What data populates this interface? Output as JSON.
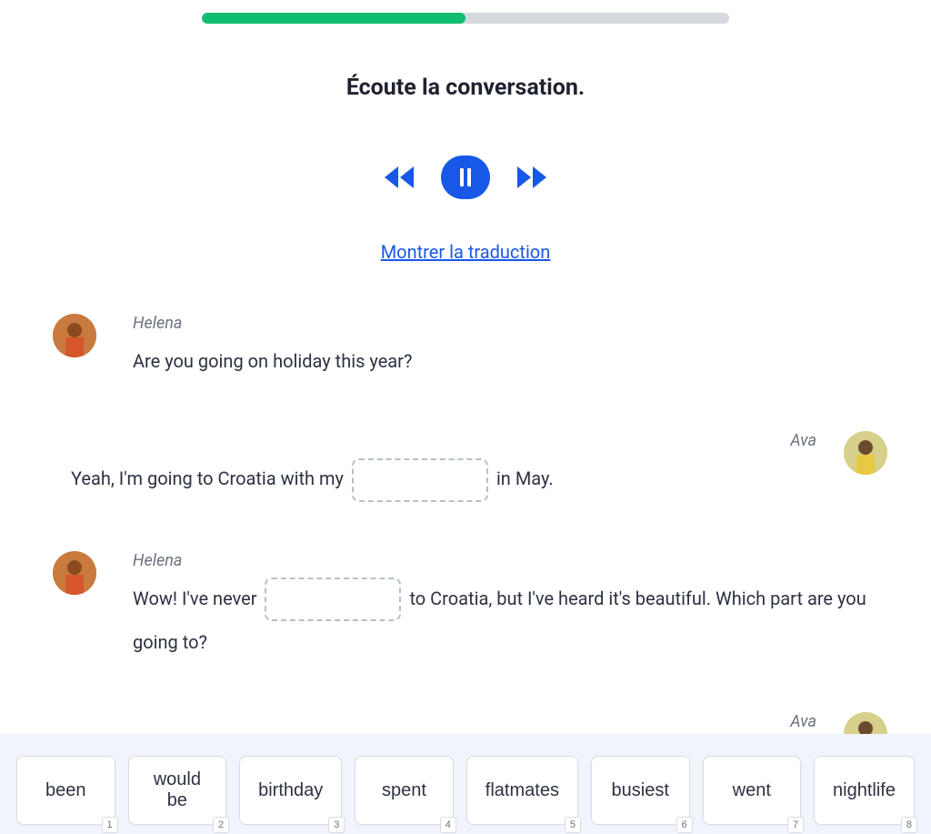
{
  "progress": {
    "percent": 50
  },
  "instruction": "Écoute la conversation.",
  "translation_link": "Montrer la traduction",
  "speakers": {
    "helena": "Helena",
    "ava": "Ava"
  },
  "messages": {
    "m1": {
      "speaker": "Helena",
      "text": "Are you going on holiday this year?"
    },
    "m2": {
      "speaker": "Ava",
      "text_before": "Yeah, I'm going to Croatia with my ",
      "text_after": " in May."
    },
    "m3": {
      "speaker": "Helena",
      "text_before": "Wow! I've never ",
      "text_after": " to Croatia, but I've heard it's beautiful. Which part are you going to?"
    },
    "m4": {
      "speaker": "Ava"
    }
  },
  "word_bank": [
    {
      "word": "been",
      "shortcut": "1"
    },
    {
      "word": "would be",
      "shortcut": "2"
    },
    {
      "word": "birthday",
      "shortcut": "3"
    },
    {
      "word": "spent",
      "shortcut": "4"
    },
    {
      "word": "flatmates",
      "shortcut": "5"
    },
    {
      "word": "busiest",
      "shortcut": "6"
    },
    {
      "word": "went",
      "shortcut": "7"
    },
    {
      "word": "nightlife",
      "shortcut": "8"
    }
  ]
}
